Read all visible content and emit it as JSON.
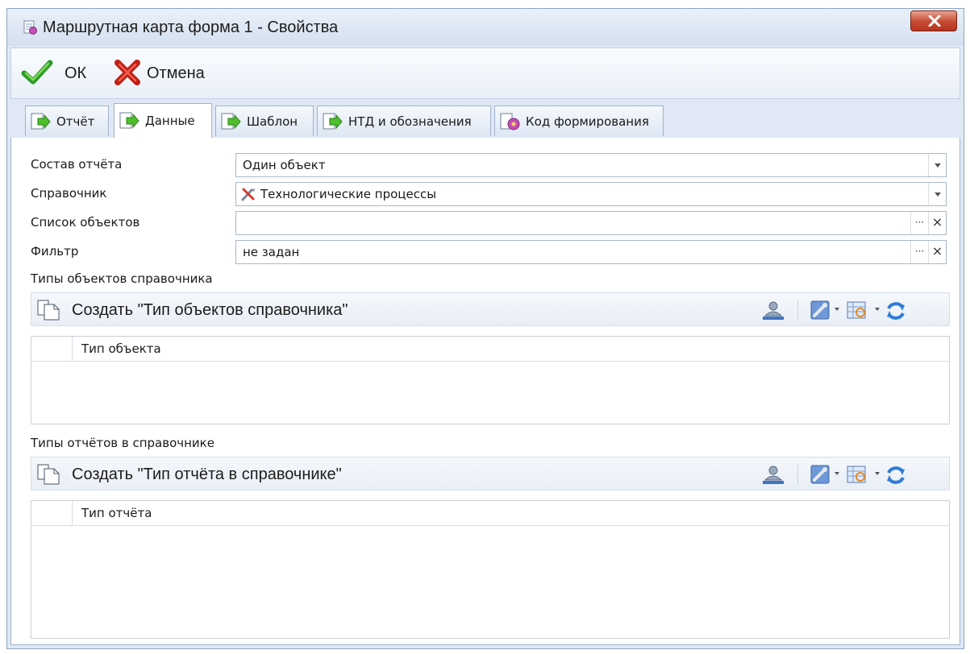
{
  "window": {
    "title": "Маршрутная карта форма 1 - Свойства",
    "close_icon": "close-icon"
  },
  "actions": {
    "ok_label": "ОК",
    "cancel_label": "Отмена"
  },
  "tabs": [
    {
      "label": "Отчёт",
      "icon": "report-arrow-icon",
      "active": false
    },
    {
      "label": "Данные",
      "icon": "data-arrow-icon",
      "active": true
    },
    {
      "label": "Шаблон",
      "icon": "template-arrow-icon",
      "active": false
    },
    {
      "label": "НТД и обозначения",
      "icon": "ntd-arrow-icon",
      "active": false
    },
    {
      "label": "Код формирования",
      "icon": "code-gear-icon",
      "active": false
    }
  ],
  "fields": {
    "report_composition": {
      "label": "Состав отчёта",
      "value": "Один объект"
    },
    "reference": {
      "label": "Справочник",
      "value": "Технологические процессы",
      "icon": "tools-icon"
    },
    "object_list": {
      "label": "Список объектов",
      "value": ""
    },
    "filter": {
      "label": "Фильтр",
      "value": "не задан"
    }
  },
  "object_types": {
    "section_label": "Типы объектов справочника",
    "create_label": "Создать \"Тип объектов справочника\"",
    "column": "Тип объекта"
  },
  "report_types": {
    "section_label": "Типы отчётов в справочнике",
    "create_label": "Создать \"Тип отчёта в справочнике\"",
    "column": "Тип отчёта"
  },
  "colors": {
    "accent": "#2f6db5",
    "ok_green": "#3aa635",
    "cancel_red": "#d8281b"
  }
}
